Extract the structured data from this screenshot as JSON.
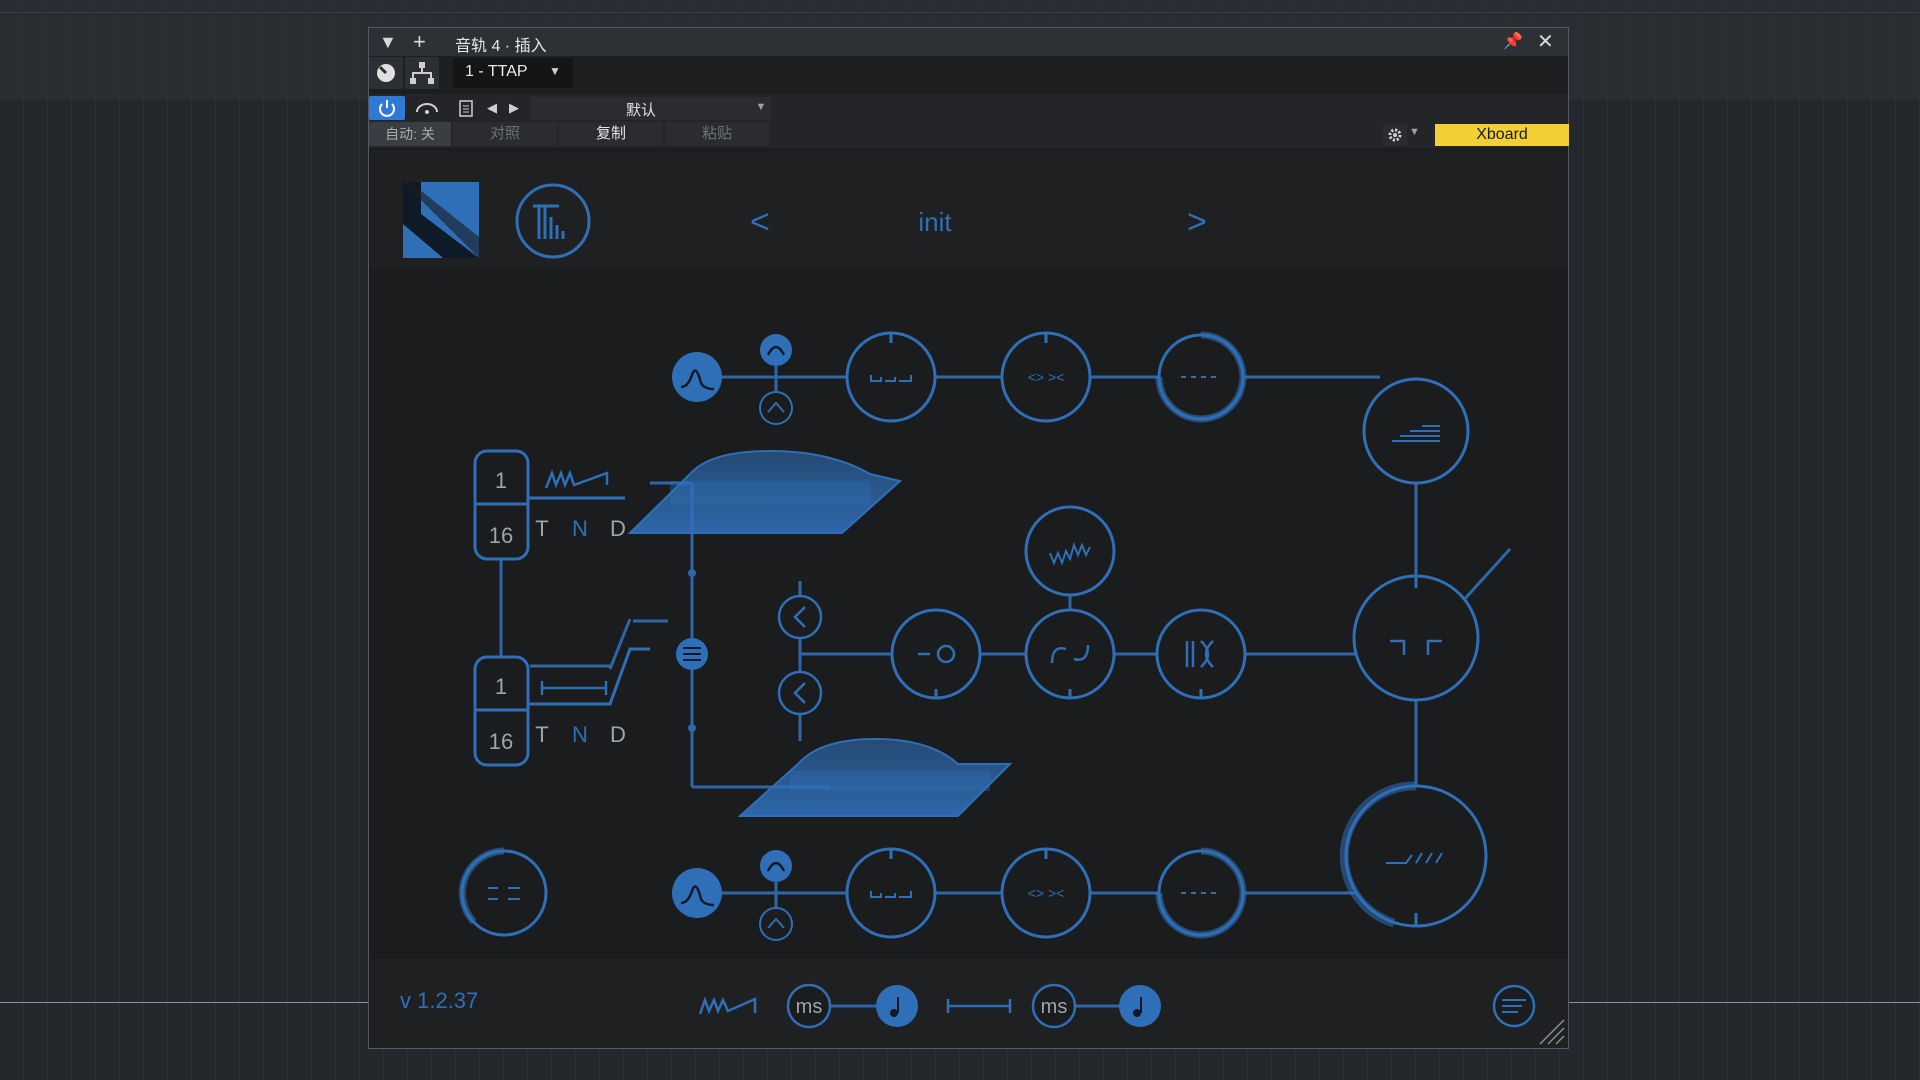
{
  "window": {
    "title": "音轨 4 · 插入",
    "preset_slot": "1 - TTAP",
    "preset_name": "默认",
    "auto_label": "自动: 关",
    "compare_label": "对照",
    "copy_label": "复制",
    "paste_label": "粘贴",
    "keyboard_label": "Xboard"
  },
  "plugin": {
    "preset": "init",
    "prev_label": "<",
    "next_label": ">",
    "version": "v 1.2.37",
    "tap1": {
      "num": "1",
      "den": "16",
      "t": "T",
      "n": "N",
      "d": "D"
    },
    "tap2": {
      "num": "1",
      "den": "16",
      "t": "T",
      "n": "N",
      "d": "D"
    },
    "ms1": "ms",
    "ms2": "ms"
  },
  "colors": {
    "accent": "#2f6fb8",
    "line": "#2e66aa",
    "keyboard_button": "#f1cf35",
    "power_active": "#2f7ad4"
  }
}
